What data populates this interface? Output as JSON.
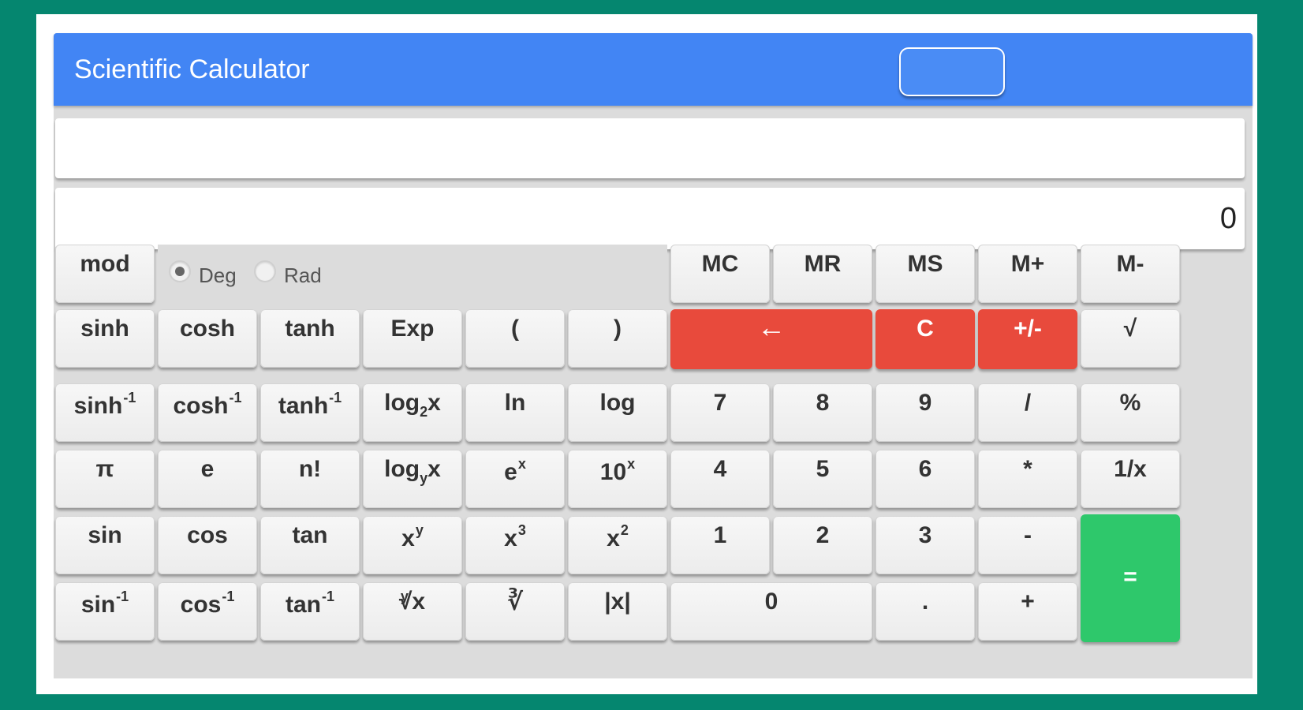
{
  "app": {
    "title": "Scientific Calculator"
  },
  "display": {
    "expression": "",
    "result": "0"
  },
  "angle_mode": {
    "deg_label": "Deg",
    "rad_label": "Rad",
    "selected": "Deg"
  },
  "keys": {
    "mod": "mod",
    "mc": "MC",
    "mr": "MR",
    "ms": "MS",
    "mplus": "M+",
    "mminus": "M-",
    "sinh": "sinh",
    "cosh": "cosh",
    "tanh": "tanh",
    "exp": "Exp",
    "lparen": "(",
    "rparen": ")",
    "backspace": "←",
    "clear": "C",
    "negate": "+/-",
    "sqrt": "√",
    "asinh": "sinh",
    "acosh": "cosh",
    "atanh": "tanh",
    "inv_sup": "-1",
    "log2_base": "log",
    "log2_sub": "2",
    "log2_arg": "x",
    "ln": "ln",
    "log": "log",
    "seven": "7",
    "eight": "8",
    "nine": "9",
    "divide": "/",
    "percent": "%",
    "pi": "π",
    "e": "e",
    "factorial": "n!",
    "logy_base": "log",
    "logy_sub": "y",
    "logy_arg": "x",
    "ex_base": "e",
    "ex_sup": "x",
    "tenx_base": "10",
    "tenx_sup": "x",
    "four": "4",
    "five": "5",
    "six": "6",
    "multiply": "*",
    "reciprocal": "1/x",
    "sin": "sin",
    "cos": "cos",
    "tan": "tan",
    "xy_base": "x",
    "xy_sup": "y",
    "x3_base": "x",
    "x3_sup": "3",
    "x2_base": "x",
    "x2_sup": "2",
    "one": "1",
    "two": "2",
    "three": "3",
    "minus": "-",
    "equals": "=",
    "asin": "sin",
    "acos": "cos",
    "atan": "tan",
    "yroot_sup": "y",
    "yroot_base": "√x",
    "cbrt": "∛",
    "abs": "|x|",
    "zero": "0",
    "dot": ".",
    "plus": "+"
  }
}
